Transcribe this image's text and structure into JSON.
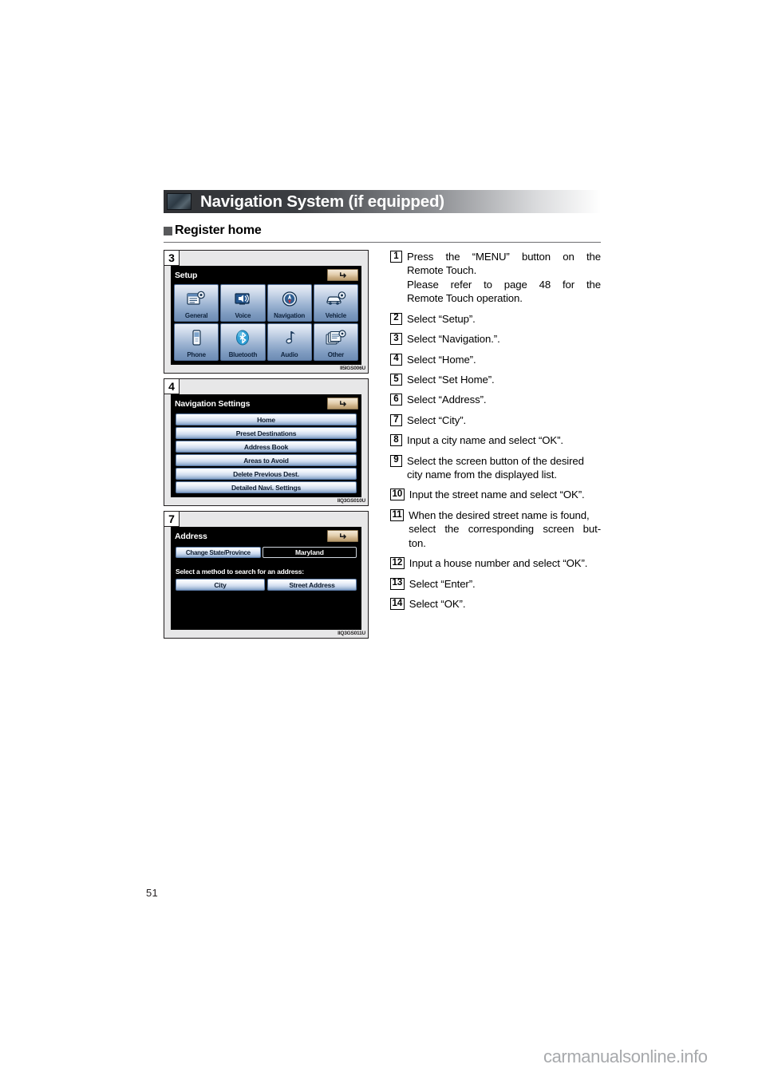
{
  "header": {
    "chapter_title": "Navigation System (if equipped)",
    "section_title": "Register home"
  },
  "figures": [
    {
      "badge": "3",
      "code": "II5IGS006U",
      "screen_title": "Setup",
      "back_icon": "return-arrow-icon",
      "type": "grid",
      "cells": [
        {
          "label": "General",
          "icon": "list-gear-icon"
        },
        {
          "label": "Voice",
          "icon": "speaker-screen-icon"
        },
        {
          "label": "Navigation",
          "icon": "compass-icon"
        },
        {
          "label": "Vehicle",
          "icon": "car-gear-icon"
        },
        {
          "label": "Phone",
          "icon": "phone-icon"
        },
        {
          "label": "Bluetooth",
          "icon": "bluetooth-icon"
        },
        {
          "label": "Audio",
          "icon": "music-note-icon"
        },
        {
          "label": "Other",
          "icon": "pages-gear-icon"
        }
      ]
    },
    {
      "badge": "4",
      "code": "IIQ3GS010U",
      "screen_title": "Navigation Settings",
      "back_icon": "return-arrow-icon",
      "type": "list",
      "items": [
        "Home",
        "Preset Destinations",
        "Address Book",
        "Areas to Avoid",
        "Delete Previous Dest.",
        "Detailed Navi. Settings"
      ]
    },
    {
      "badge": "7",
      "code": "IIQ3GS011U",
      "screen_title": "Address",
      "back_icon": "return-arrow-icon",
      "type": "address",
      "change_state_label": "Change State/Province",
      "state_value": "Maryland",
      "prompt": "Select a method to search for an address:",
      "methods": [
        "City",
        "Street Address"
      ]
    }
  ],
  "steps": [
    {
      "num": "1",
      "lines": [
        "Press the “MENU” button on the",
        "Remote Touch.",
        "Please refer to page 48 for the",
        "Remote Touch operation."
      ]
    },
    {
      "num": "2",
      "lines": [
        "Select “Setup”."
      ]
    },
    {
      "num": "3",
      "lines": [
        "Select “Navigation.”."
      ]
    },
    {
      "num": "4",
      "lines": [
        "Select “Home”."
      ]
    },
    {
      "num": "5",
      "lines": [
        "Select “Set Home”."
      ]
    },
    {
      "num": "6",
      "lines": [
        "Select “Address”."
      ]
    },
    {
      "num": "7",
      "lines": [
        "Select “City”."
      ]
    },
    {
      "num": "8",
      "lines": [
        "Input a city name and select “OK”."
      ]
    },
    {
      "num": "9",
      "lines": [
        "Select the screen button of the desired",
        "city name from the displayed list."
      ]
    },
    {
      "num": "10",
      "lines": [
        "Input the street name and select “OK”."
      ]
    },
    {
      "num": "11",
      "lines": [
        "When the desired street name is found,",
        "select the corresponding screen but-",
        "ton."
      ]
    },
    {
      "num": "12",
      "lines": [
        "Input a house number and select “OK”."
      ]
    },
    {
      "num": "13",
      "lines": [
        "Select “Enter”."
      ]
    },
    {
      "num": "14",
      "lines": [
        "Select “OK”."
      ]
    }
  ],
  "footer": {
    "page_number": "51",
    "watermark": "carmanualsonline.info"
  }
}
